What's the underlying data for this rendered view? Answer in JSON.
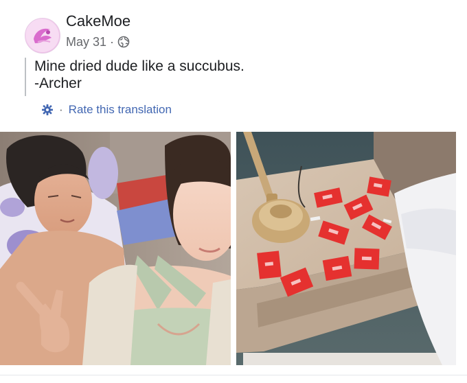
{
  "post": {
    "author": "CakeMoe",
    "date": "May 31",
    "separator": "·",
    "audience_icon": "globe-icon",
    "text_lines": [
      "Mine dried dude like a succubus.",
      "-Archer"
    ],
    "translation": {
      "icon": "gear-icon",
      "separator": "·",
      "link_label": "Rate this translation"
    },
    "photos": [
      {
        "icon": "photo-couple-selfie"
      },
      {
        "icon": "photo-nightstand-wrappers"
      }
    ]
  },
  "colors": {
    "link": "#4267b2",
    "meta": "#65676b",
    "wrapper_red": "#e8262b"
  }
}
